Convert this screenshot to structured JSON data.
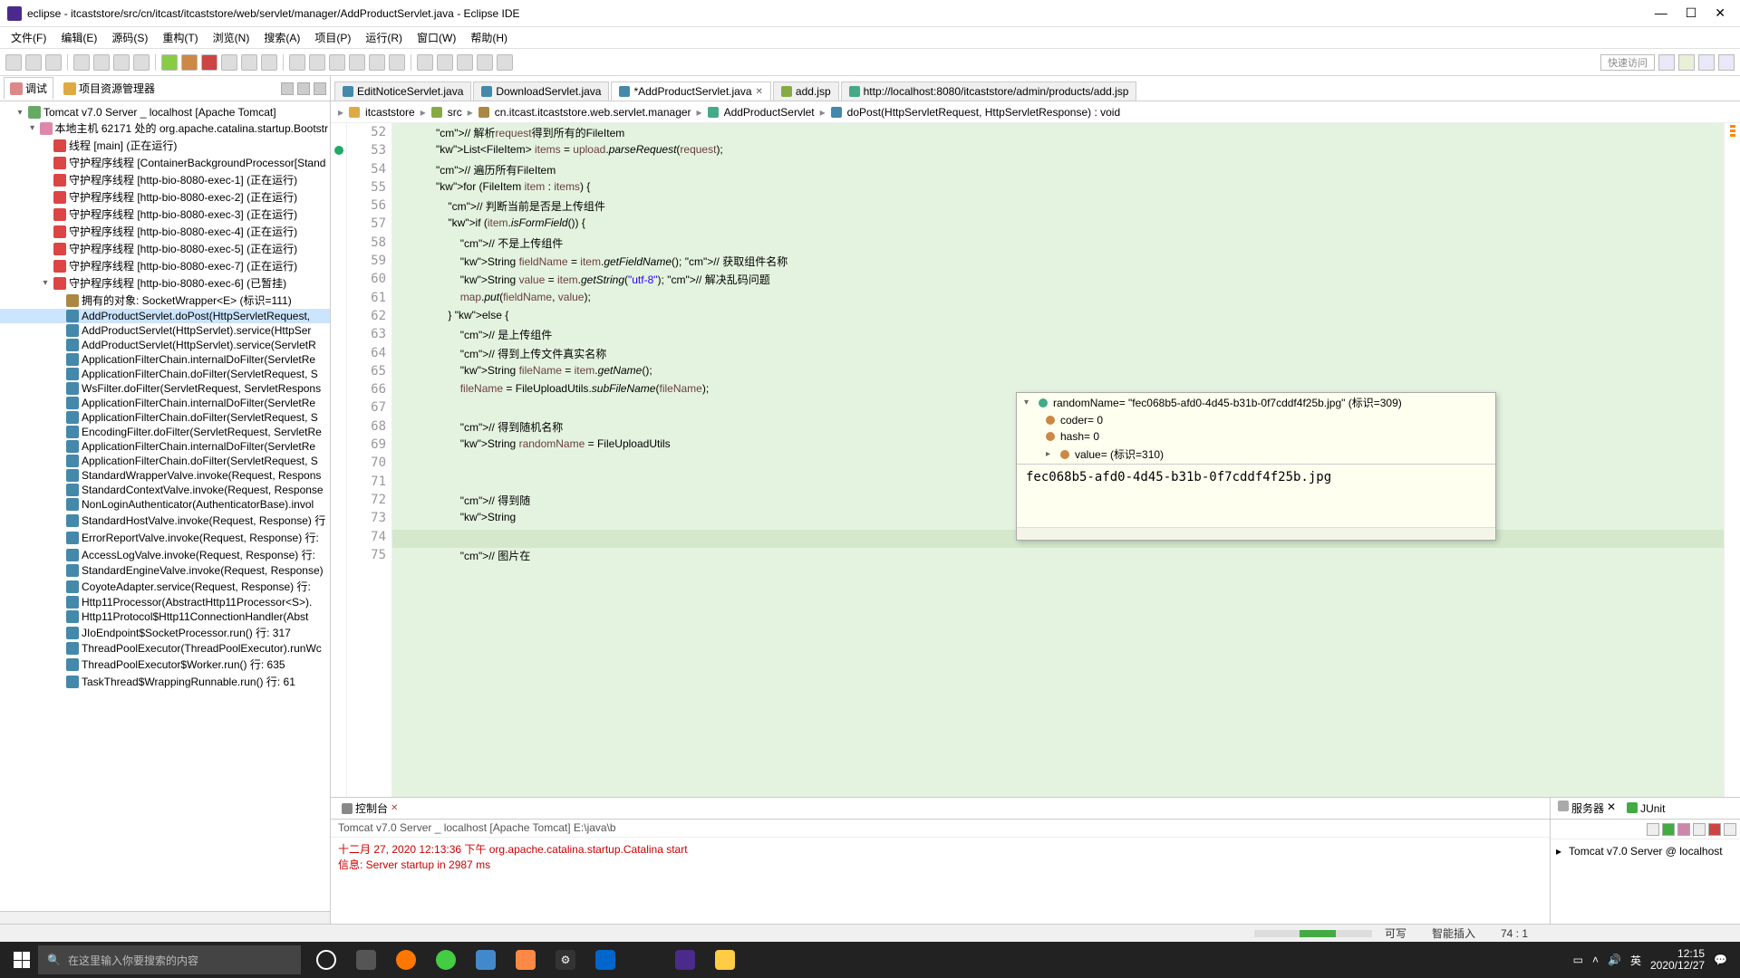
{
  "window": {
    "title": "eclipse - itcaststore/src/cn/itcast/itcaststore/web/servlet/manager/AddProductServlet.java - Eclipse IDE"
  },
  "menus": [
    "文件(F)",
    "编辑(E)",
    "源码(S)",
    "重构(T)",
    "浏览(N)",
    "搜索(A)",
    "项目(P)",
    "运行(R)",
    "窗口(W)",
    "帮助(H)"
  ],
  "quickaccess": "快速访问",
  "leftTabs": {
    "debug": "调试",
    "explorer": "项目资源管理器"
  },
  "debugTree": {
    "server": "Tomcat v7.0 Server _ localhost [Apache Tomcat]",
    "host": "本地主机 62171 处的 org.apache.catalina.startup.Bootstr",
    "threads": [
      "线程 [main]  (正在运行)",
      "守护程序线程 [ContainerBackgroundProcessor[Stand",
      "守护程序线程 [http-bio-8080-exec-1]  (正在运行)",
      "守护程序线程 [http-bio-8080-exec-2]  (正在运行)",
      "守护程序线程 [http-bio-8080-exec-3]  (正在运行)",
      "守护程序线程 [http-bio-8080-exec-4]  (正在运行)",
      "守护程序线程 [http-bio-8080-exec-5]  (正在运行)",
      "守护程序线程 [http-bio-8080-exec-7]  (正在运行)"
    ],
    "paused": "守护程序线程 [http-bio-8080-exec-6]  (已暂挂)",
    "owned": "拥有的对象:  SocketWrapper<E>    (标识=111)",
    "frames": [
      "AddProductServlet.doPost(HttpServletRequest,",
      "AddProductServlet(HttpServlet).service(HttpSer",
      "AddProductServlet(HttpServlet).service(ServletR",
      "ApplicationFilterChain.internalDoFilter(ServletRe",
      "ApplicationFilterChain.doFilter(ServletRequest, S",
      "WsFilter.doFilter(ServletRequest, ServletRespons",
      "ApplicationFilterChain.internalDoFilter(ServletRe",
      "ApplicationFilterChain.doFilter(ServletRequest, S",
      "EncodingFilter.doFilter(ServletRequest, ServletRe",
      "ApplicationFilterChain.internalDoFilter(ServletRe",
      "ApplicationFilterChain.doFilter(ServletRequest, S",
      "StandardWrapperValve.invoke(Request, Respons",
      "StandardContextValve.invoke(Request, Response",
      "NonLoginAuthenticator(AuthenticatorBase).invol",
      "StandardHostValve.invoke(Request, Response) 行",
      "ErrorReportValve.invoke(Request, Response) 行:",
      "AccessLogValve.invoke(Request, Response) 行:",
      "StandardEngineValve.invoke(Request, Response)",
      "CoyoteAdapter.service(Request, Response) 行:",
      "Http11Processor(AbstractHttp11Processor<S>).",
      "Http11Protocol$Http11ConnectionHandler(Abst",
      "JIoEndpoint$SocketProcessor.run() 行:  317",
      "ThreadPoolExecutor(ThreadPoolExecutor).runWc",
      "ThreadPoolExecutor$Worker.run() 行:  635",
      "TaskThread$WrappingRunnable.run() 行:  61"
    ]
  },
  "editorTabs": [
    {
      "name": "EditNoticeServlet.java",
      "active": false,
      "icon": "java"
    },
    {
      "name": "DownloadServlet.java",
      "active": false,
      "icon": "java"
    },
    {
      "name": "*AddProductServlet.java",
      "active": true,
      "icon": "java",
      "close": true
    },
    {
      "name": "add.jsp",
      "active": false,
      "icon": "jsp"
    },
    {
      "name": "http://localhost:8080/itcaststore/admin/products/add.jsp",
      "active": false,
      "icon": "web"
    }
  ],
  "breadcrumb": [
    "itcaststore",
    "src",
    "cn.itcast.itcaststore.web.servlet.manager",
    "AddProductServlet",
    "doPost(HttpServletRequest, HttpServletResponse) : void"
  ],
  "code": {
    "start": 52,
    "current": 74,
    "lines": [
      "            // 解析request得到所有的FileItem",
      "            List<FileItem> items = upload.parseRequest(request);",
      "            // 遍历所有FileItem",
      "            for (FileItem item : items) {",
      "                // 判断当前是否是上传组件",
      "                if (item.isFormField()) {",
      "                    // 不是上传组件",
      "                    String fieldName = item.getFieldName(); // 获取组件名称",
      "                    String value = item.getString(\"utf-8\"); // 解决乱码问题",
      "                    map.put(fieldName, value);",
      "                } else {",
      "                    // 是上传组件",
      "                    // 得到上传文件真实名称",
      "                    String fileName = item.getName();",
      "                    fileName = FileUploadUtils.subFileName(fileName);",
      "",
      "                    // 得到随机名称",
      "                    String randomName = FileUploadUtils",
      "",
      "",
      "                    // 得到随",
      "                    String ",
      "",
      "                    // 图片在"
    ]
  },
  "popup": {
    "line1": "randomName= \"fec068b5-afd0-4d45-b31b-0f7cddf4f25b.jpg\"   (标识=309)",
    "coder": "coder= 0",
    "hash": "hash= 0",
    "value": "value=   (标识=310)",
    "detail": "fec068b5-afd0-4d45-b31b-0f7cddf4f25b.jpg"
  },
  "console": {
    "tab": "控制台",
    "info": "Tomcat v7.0 Server _ localhost [Apache Tomcat] E:\\java\\b",
    "line1": "十二月 27, 2020 12:13:36 下午 org.apache.catalina.startup.Catalina start",
    "line2": "信息: Server startup in 2987 ms"
  },
  "servers": {
    "tab1": "服务器",
    "tab2": "JUnit",
    "item": "Tomcat v7.0 Server @ localhost"
  },
  "status": {
    "writable": "可写",
    "insert": "智能插入",
    "pos": "74 : 1"
  },
  "taskbar": {
    "search": "在这里输入你要搜索的内容",
    "ime": "英",
    "time": "12:15",
    "date": "2020/12/27"
  }
}
